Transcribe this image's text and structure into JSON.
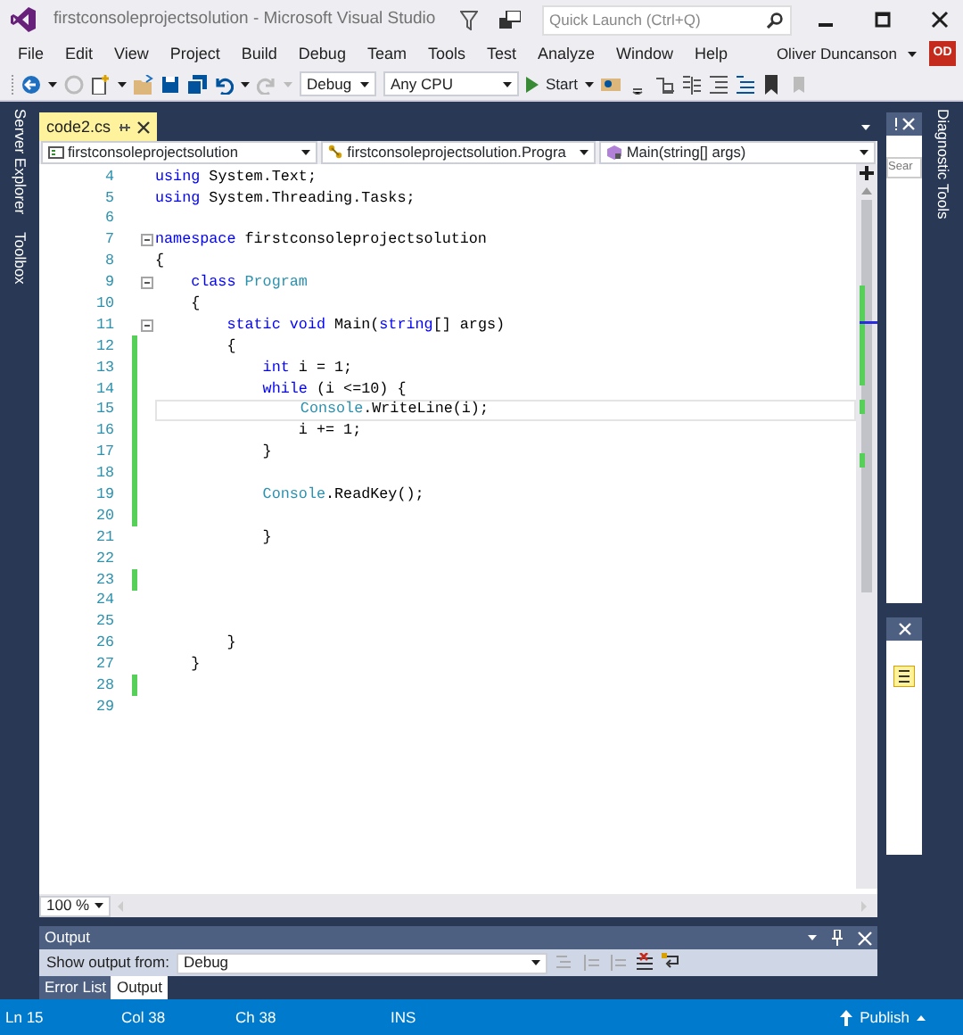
{
  "window": {
    "title": "firstconsoleprojectsolution - Microsoft Visual Studio",
    "quick_launch": {
      "placeholder": "Quick Launch (Ctrl+Q)"
    }
  },
  "menu": [
    "File",
    "Edit",
    "View",
    "Project",
    "Build",
    "Debug",
    "Team",
    "Tools",
    "Test",
    "Analyze",
    "Window",
    "Help"
  ],
  "account": {
    "name": "Oliver Duncanson",
    "initials": "OD"
  },
  "toolbar": {
    "configuration": "Debug",
    "platform": "Any CPU",
    "start": "Start"
  },
  "side_tabs_left": [
    "Server Explorer",
    "Toolbox"
  ],
  "side_tabs_right": [
    "Diagnostic Tools"
  ],
  "document_tabs": [
    {
      "label": "code2.cs",
      "selected": true
    }
  ],
  "navigation": [
    "firstconsoleprojectsolution",
    "firstconsoleprojectsolution.Progra",
    "Main(string[] args)"
  ],
  "editor": {
    "zoom": "100 %",
    "lines": [
      {
        "number": "4",
        "changed": false,
        "foldable": false,
        "current": false,
        "tokens": [
          {
            "kind": "keyword",
            "text": "using"
          },
          {
            "kind": "plain",
            "text": " System.Text;"
          }
        ]
      },
      {
        "number": "5",
        "changed": false,
        "foldable": false,
        "current": false,
        "tokens": [
          {
            "kind": "keyword",
            "text": "using"
          },
          {
            "kind": "plain",
            "text": " System.Threading.Tasks;"
          }
        ]
      },
      {
        "number": "6",
        "changed": false,
        "foldable": false,
        "current": false
      },
      {
        "number": "7",
        "changed": false,
        "foldable": true,
        "current": false,
        "tokens": [
          {
            "kind": "keyword",
            "text": "namespace"
          },
          {
            "kind": "plain",
            "text": " firstconsoleprojectsolution"
          }
        ]
      },
      {
        "number": "8",
        "changed": false,
        "foldable": false,
        "current": false,
        "tokens": [
          {
            "kind": "plain",
            "text": "{"
          }
        ]
      },
      {
        "number": "9",
        "changed": false,
        "foldable": true,
        "current": false,
        "tokens": [
          {
            "kind": "keyword",
            "text": "    class"
          },
          {
            "kind": "type",
            "text": " Program"
          }
        ]
      },
      {
        "number": "10",
        "changed": false,
        "foldable": false,
        "current": false,
        "tokens": [
          {
            "kind": "plain",
            "text": "    {"
          }
        ]
      },
      {
        "number": "11",
        "changed": false,
        "foldable": true,
        "current": false,
        "tokens": [
          {
            "kind": "keyword",
            "text": "        static void"
          },
          {
            "kind": "plain",
            "text": " Main("
          },
          {
            "kind": "keyword",
            "text": "string"
          },
          {
            "kind": "plain",
            "text": "[] args)"
          }
        ]
      },
      {
        "number": "12",
        "changed": true,
        "foldable": false,
        "current": false,
        "tokens": [
          {
            "kind": "plain",
            "text": "        {"
          }
        ]
      },
      {
        "number": "13",
        "changed": true,
        "foldable": false,
        "current": false,
        "tokens": [
          {
            "kind": "keyword",
            "text": "            int"
          },
          {
            "kind": "plain",
            "text": " i = 1;"
          }
        ]
      },
      {
        "number": "14",
        "changed": true,
        "foldable": false,
        "current": false,
        "tokens": [
          {
            "kind": "keyword",
            "text": "            while"
          },
          {
            "kind": "plain",
            "text": " (i <=10) {"
          }
        ]
      },
      {
        "number": "15",
        "changed": true,
        "foldable": false,
        "current": true,
        "tokens": [
          {
            "kind": "type",
            "text": "                Console"
          },
          {
            "kind": "plain",
            "text": ".WriteLine(i);"
          }
        ]
      },
      {
        "number": "16",
        "changed": true,
        "foldable": false,
        "current": false,
        "tokens": [
          {
            "kind": "plain",
            "text": "                i += 1;"
          }
        ]
      },
      {
        "number": "17",
        "changed": true,
        "foldable": false,
        "current": false,
        "tokens": [
          {
            "kind": "plain",
            "text": "            }"
          }
        ]
      },
      {
        "number": "18",
        "changed": true,
        "foldable": false,
        "current": false
      },
      {
        "number": "19",
        "changed": true,
        "foldable": false,
        "current": false,
        "tokens": [
          {
            "kind": "type",
            "text": "            Console"
          },
          {
            "kind": "plain",
            "text": ".ReadKey();"
          }
        ]
      },
      {
        "number": "20",
        "changed": true,
        "foldable": false,
        "current": false
      },
      {
        "number": "21",
        "changed": false,
        "foldable": false,
        "current": false,
        "tokens": [
          {
            "kind": "plain",
            "text": "            }"
          }
        ]
      },
      {
        "number": "22",
        "changed": false,
        "foldable": false,
        "current": false
      },
      {
        "number": "23",
        "changed": true,
        "foldable": false,
        "current": false
      },
      {
        "number": "24",
        "changed": false,
        "foldable": false,
        "current": false
      },
      {
        "number": "25",
        "changed": false,
        "foldable": false,
        "current": false
      },
      {
        "number": "26",
        "changed": false,
        "foldable": false,
        "current": false,
        "tokens": [
          {
            "kind": "plain",
            "text": "        }"
          }
        ]
      },
      {
        "number": "27",
        "changed": false,
        "foldable": false,
        "current": false,
        "tokens": [
          {
            "kind": "plain",
            "text": "    }"
          }
        ]
      },
      {
        "number": "28",
        "changed": true,
        "foldable": false,
        "current": false
      },
      {
        "number": "29",
        "changed": false,
        "foldable": false,
        "current": false
      }
    ]
  },
  "diagnostic_panel": {
    "search_placeholder": "Sear"
  },
  "output": {
    "title": "Output",
    "source_label": "Show output from:",
    "source": "Debug",
    "tabs": [
      {
        "label": "Error List",
        "selected": false
      },
      {
        "label": "Output",
        "selected": true
      }
    ]
  },
  "status_bar": {
    "items": [
      "Ln 15",
      "Col 38",
      "Ch 38",
      "INS"
    ],
    "publish": "Publish"
  }
}
